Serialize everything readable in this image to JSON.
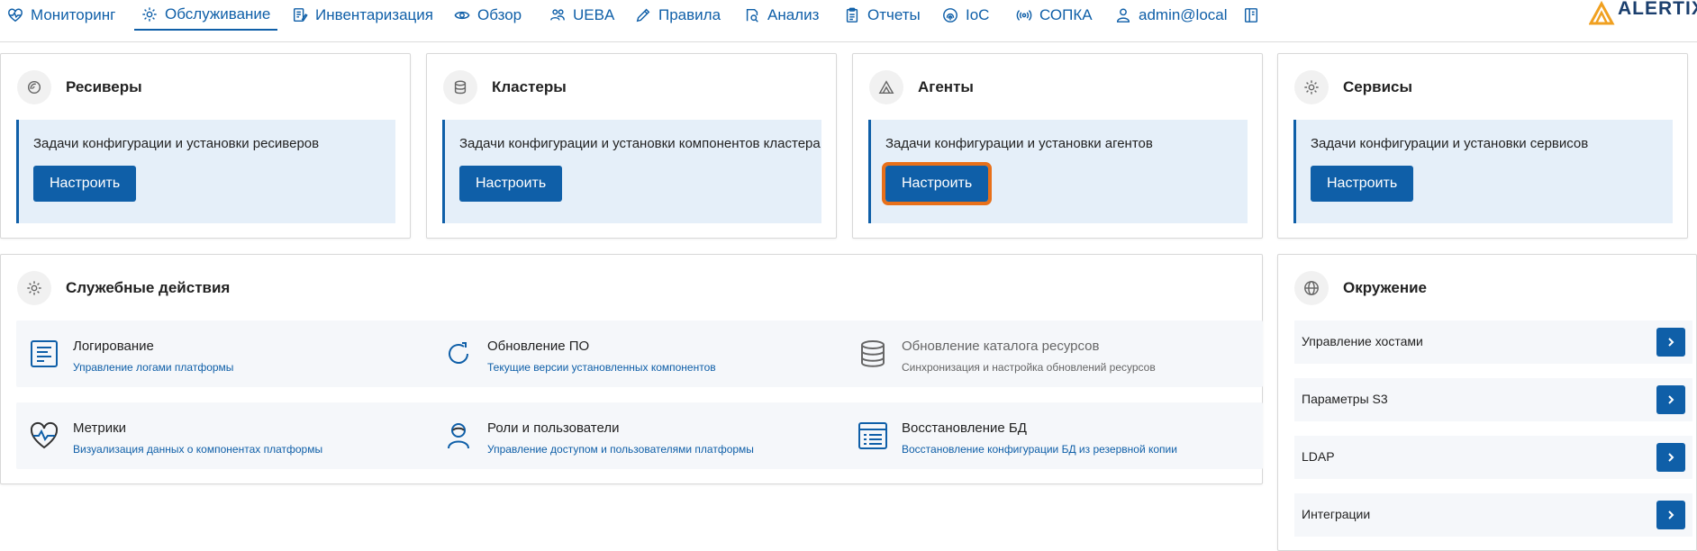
{
  "nav": {
    "items": [
      {
        "label": "Мониторинг",
        "icon": "heartbeat-icon"
      },
      {
        "label": "Обслуживание",
        "icon": "gear-icon",
        "active": true
      },
      {
        "label": "Инвентаризация",
        "icon": "edit-list-icon"
      },
      {
        "label": "Обзор",
        "icon": "eye-icon"
      },
      {
        "label": "UEBA",
        "icon": "users-icon"
      },
      {
        "label": "Правила",
        "icon": "pencil-icon"
      },
      {
        "label": "Анализ",
        "icon": "search-doc-icon"
      },
      {
        "label": "Отчеты",
        "icon": "clipboard-icon"
      },
      {
        "label": "IoC",
        "icon": "fingerprint-icon"
      },
      {
        "label": "СОПКА",
        "icon": "broadcast-icon"
      },
      {
        "label": "admin@local",
        "icon": "user-icon"
      }
    ],
    "help_icon": "book-icon",
    "logo_text": "ALERTIX"
  },
  "config_cards": [
    {
      "title": "Ресиверы",
      "icon": "receiver-icon",
      "description": "Задачи конфигурации и установки ресиверов",
      "button": "Настроить"
    },
    {
      "title": "Кластеры",
      "icon": "database-icon",
      "description": "Задачи конфигурации и установки компонентов кластера",
      "button": "Настроить"
    },
    {
      "title": "Агенты",
      "icon": "agent-icon",
      "description": "Задачи конфигурации и установки агентов",
      "button": "Настроить",
      "highlighted": true
    },
    {
      "title": "Сервисы",
      "icon": "gear-icon",
      "description": "Задачи конфигурации и установки сервисов",
      "button": "Настроить"
    }
  ],
  "service_actions": {
    "title": "Служебные действия",
    "items": [
      {
        "title": "Логирование",
        "subtitle": "Управление логами платформы",
        "icon": "log-icon"
      },
      {
        "title": "Обновление ПО",
        "subtitle": "Текущие версии установленных компонентов",
        "icon": "refresh-icon"
      },
      {
        "title": "Обновление каталога ресурсов",
        "subtitle": "Синхронизация и настройка обновлений ресурсов",
        "icon": "database-stack-icon",
        "disabled": true
      },
      {
        "title": "Метрики",
        "subtitle": "Визуализация данных о компонентах платформы",
        "icon": "heart-pulse-icon"
      },
      {
        "title": "Роли и пользователи",
        "subtitle": "Управление доступом и пользователями платформы",
        "icon": "user-role-icon"
      },
      {
        "title": "Восстановление БД",
        "subtitle": "Восстановление конфигурации БД из резервной копии",
        "icon": "list-icon"
      }
    ]
  },
  "environment": {
    "title": "Окружение",
    "items": [
      "Управление хостами",
      "Параметры S3",
      "LDAP",
      "Интеграции"
    ]
  },
  "colors": {
    "accent": "#0f5fa8",
    "highlight": "#e8701a",
    "info_bg": "#e5eff9"
  }
}
